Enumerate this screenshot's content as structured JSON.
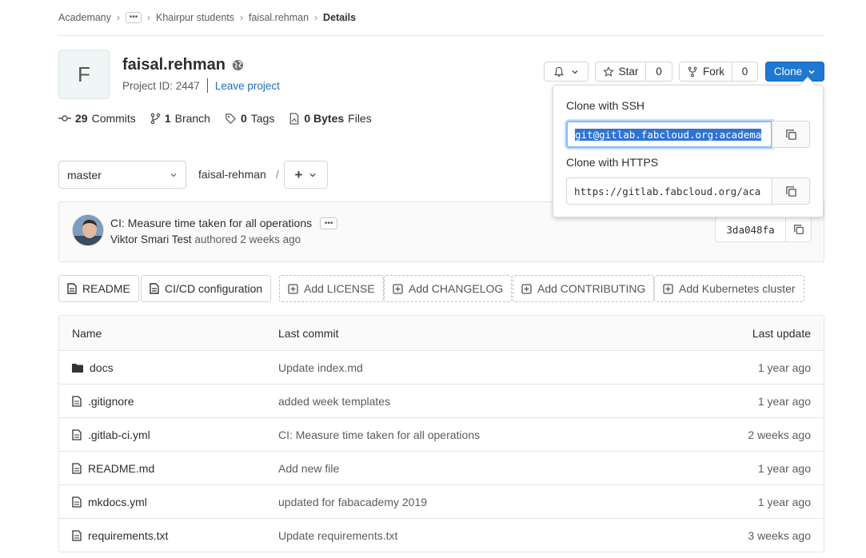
{
  "breadcrumb": {
    "root": "Academany",
    "group": "Khairpur students",
    "project": "faisal.rehman",
    "current": "Details"
  },
  "project": {
    "avatar_letter": "F",
    "name": "faisal.rehman",
    "id_label": "Project ID: 2447",
    "leave_label": "Leave project"
  },
  "actions": {
    "star_label": "Star",
    "star_count": "0",
    "fork_label": "Fork",
    "fork_count": "0",
    "clone_label": "Clone"
  },
  "stats": {
    "commits_count": "29",
    "commits_label": "Commits",
    "branch_count": "1",
    "branch_label": "Branch",
    "tags_count": "0",
    "tags_label": "Tags",
    "files_count": "0 Bytes",
    "files_label": "Files"
  },
  "branch": {
    "selected": "master",
    "path": "faisal-rehman",
    "add_label": "+"
  },
  "commit": {
    "title": "CI: Measure time taken for all operations",
    "author": "Viktor Smari Test",
    "authored_text": "authored 2 weeks ago",
    "sha": "3da048fa"
  },
  "shortcuts": [
    {
      "label": "README"
    },
    {
      "label": "CI/CD configuration"
    },
    {
      "label": "Add LICENSE"
    },
    {
      "label": "Add CHANGELOG"
    },
    {
      "label": "Add CONTRIBUTING"
    },
    {
      "label": "Add Kubernetes cluster"
    }
  ],
  "table": {
    "headers": {
      "name": "Name",
      "last_commit": "Last commit",
      "last_update": "Last update"
    },
    "rows": [
      {
        "name": "docs",
        "type": "folder",
        "commit": "Update index.md",
        "updated": "1 year ago"
      },
      {
        "name": ".gitignore",
        "type": "file",
        "commit": "added week templates",
        "updated": "1 year ago"
      },
      {
        "name": ".gitlab-ci.yml",
        "type": "file",
        "commit": "CI: Measure time taken for all operations",
        "updated": "2 weeks ago"
      },
      {
        "name": "README.md",
        "type": "file",
        "commit": "Add new file",
        "updated": "1 year ago"
      },
      {
        "name": "mkdocs.yml",
        "type": "file",
        "commit": "updated for fabacademy 2019",
        "updated": "1 year ago"
      },
      {
        "name": "requirements.txt",
        "type": "file",
        "commit": "Update requirements.txt",
        "updated": "3 weeks ago"
      }
    ]
  },
  "clone_dropdown": {
    "ssh_label": "Clone with SSH",
    "ssh_value": "git@gitlab.fabcloud.org:academa",
    "https_label": "Clone with HTTPS",
    "https_value": "https://gitlab.fabcloud.org/aca"
  },
  "colors": {
    "accent": "#1f78d1",
    "link": "#1f6fb8"
  }
}
